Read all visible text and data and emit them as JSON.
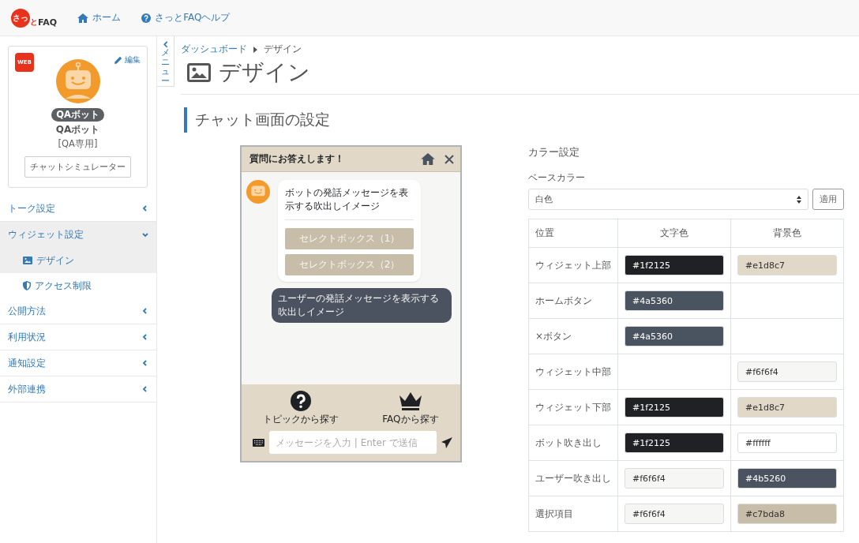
{
  "header": {
    "logo": {
      "mark": "さっ",
      "accent": "と",
      "text": "FAQ"
    },
    "links": [
      {
        "kind": "home",
        "label": "ホーム"
      },
      {
        "kind": "help",
        "label": "さっとFAQヘルプ"
      }
    ]
  },
  "profile": {
    "badge": "WEB",
    "edit": "編集",
    "tag": "QAボット",
    "name": "QAボット",
    "note": "[QA専用]",
    "button": "チャットシミュレーター"
  },
  "sidebar": {
    "items": [
      {
        "label": "トーク設定",
        "expanded": false,
        "selected": false
      },
      {
        "label": "ウィジェット設定",
        "expanded": true,
        "selected": false,
        "children": [
          {
            "kind": "image",
            "label": "デザイン",
            "selected": true
          },
          {
            "kind": "shield",
            "label": "アクセス制限",
            "selected": false
          }
        ]
      },
      {
        "label": "公開方法",
        "expanded": false,
        "selected": false
      },
      {
        "label": "利用状況",
        "expanded": false,
        "selected": false
      },
      {
        "label": "通知設定",
        "expanded": false,
        "selected": false
      },
      {
        "label": "外部連携",
        "expanded": false,
        "selected": false
      }
    ]
  },
  "menu_tab": "メニュー",
  "breadcrumb": [
    "ダッシュボード",
    "デザイン"
  ],
  "page_title": "デザイン",
  "section_title": "チャット画面の設定",
  "preview": {
    "title": "質問にお答えします！",
    "bot_message": "ボットの発話メッセージを表示する吹出しイメージ",
    "options": [
      "セレクトボックス（1）",
      "セレクトボックス（2）"
    ],
    "user_message": "ユーザーの発話メッセージを表示する吹出しイメージ",
    "shortcuts": [
      {
        "kind": "question",
        "label": "トピックから探す"
      },
      {
        "kind": "crown",
        "label": "FAQから探す"
      }
    ],
    "input": {
      "placeholder": "メッセージを入力 | Enter で送信"
    }
  },
  "colors": {
    "title": "カラー設定",
    "base_label": "ベースカラー",
    "base_value": "白色",
    "apply": "適用",
    "columns": [
      "位置",
      "文字色",
      "背景色"
    ],
    "rows": [
      {
        "position": "ウィジェット上部",
        "text": {
          "value": "#1f2125",
          "color": "#1f2125"
        },
        "background": {
          "value": "#e1d8c7",
          "color": "#e1d8c7"
        }
      },
      {
        "position": "ホームボタン",
        "text": {
          "value": "#4a5360",
          "color": "#4a5360"
        }
      },
      {
        "position": "×ボタン",
        "text": {
          "value": "#4a5360",
          "color": "#4a5360"
        }
      },
      {
        "position": "ウィジェット中部",
        "background": {
          "value": "#f6f6f4",
          "color": "#f6f6f4"
        }
      },
      {
        "position": "ウィジェット下部",
        "text": {
          "value": "#1f2125",
          "color": "#1f2125"
        },
        "background": {
          "value": "#e1d8c7",
          "color": "#e1d8c7"
        }
      },
      {
        "position": "ボット吹き出し",
        "text": {
          "value": "#1f2125",
          "color": "#1f2125"
        },
        "background": {
          "value": "#ffffff",
          "color": "#ffffff"
        }
      },
      {
        "position": "ユーザー吹き出し",
        "text": {
          "value": "#f6f6f4",
          "color": "#f6f6f4"
        },
        "background": {
          "value": "#4b5260",
          "color": "#4b5260"
        }
      },
      {
        "position": "選択項目",
        "text": {
          "value": "#f6f6f4",
          "color": "#f6f6f4"
        },
        "background": {
          "value": "#c7bda8",
          "color": "#c7bda8"
        }
      }
    ]
  }
}
